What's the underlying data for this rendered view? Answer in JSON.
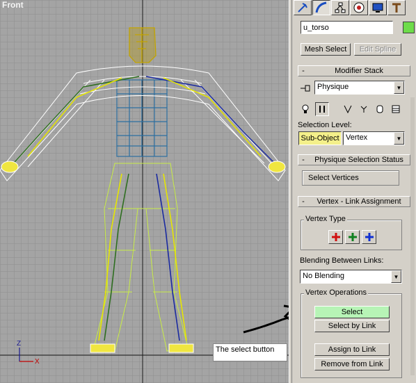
{
  "viewport": {
    "label": "Front",
    "caption": "The select button"
  },
  "panel": {
    "tabs": [
      "create-icon",
      "modify-icon",
      "hierarchy-icon",
      "motion-icon",
      "display-icon",
      "utilities-icon"
    ],
    "object_name": "u_torso",
    "object_color": "#6edc4a",
    "mesh_select_label": "Mesh Select",
    "edit_spline_label": "Edit Spline",
    "modifier_stack": {
      "title": "Modifier Stack",
      "current_modifier": "Physique",
      "selection_level_label": "Selection Level:",
      "sub_object_label": "Sub-Object",
      "level_value": "Vertex"
    },
    "physique_selection_status": {
      "title": "Physique Selection Status",
      "status_text": "Select Vertices"
    },
    "vertex_link_assignment": {
      "title": "Vertex - Link Assignment",
      "vertex_type_label": "Vertex Type",
      "blending_label": "Blending Between Links:",
      "blending_value": "No Blending",
      "vertex_operations_label": "Vertex Operations",
      "select_label": "Select",
      "select_by_link_label": "Select by Link",
      "assign_to_link_label": "Assign to Link",
      "remove_from_link_label": "Remove from Link"
    },
    "rollout_minus": "-"
  }
}
